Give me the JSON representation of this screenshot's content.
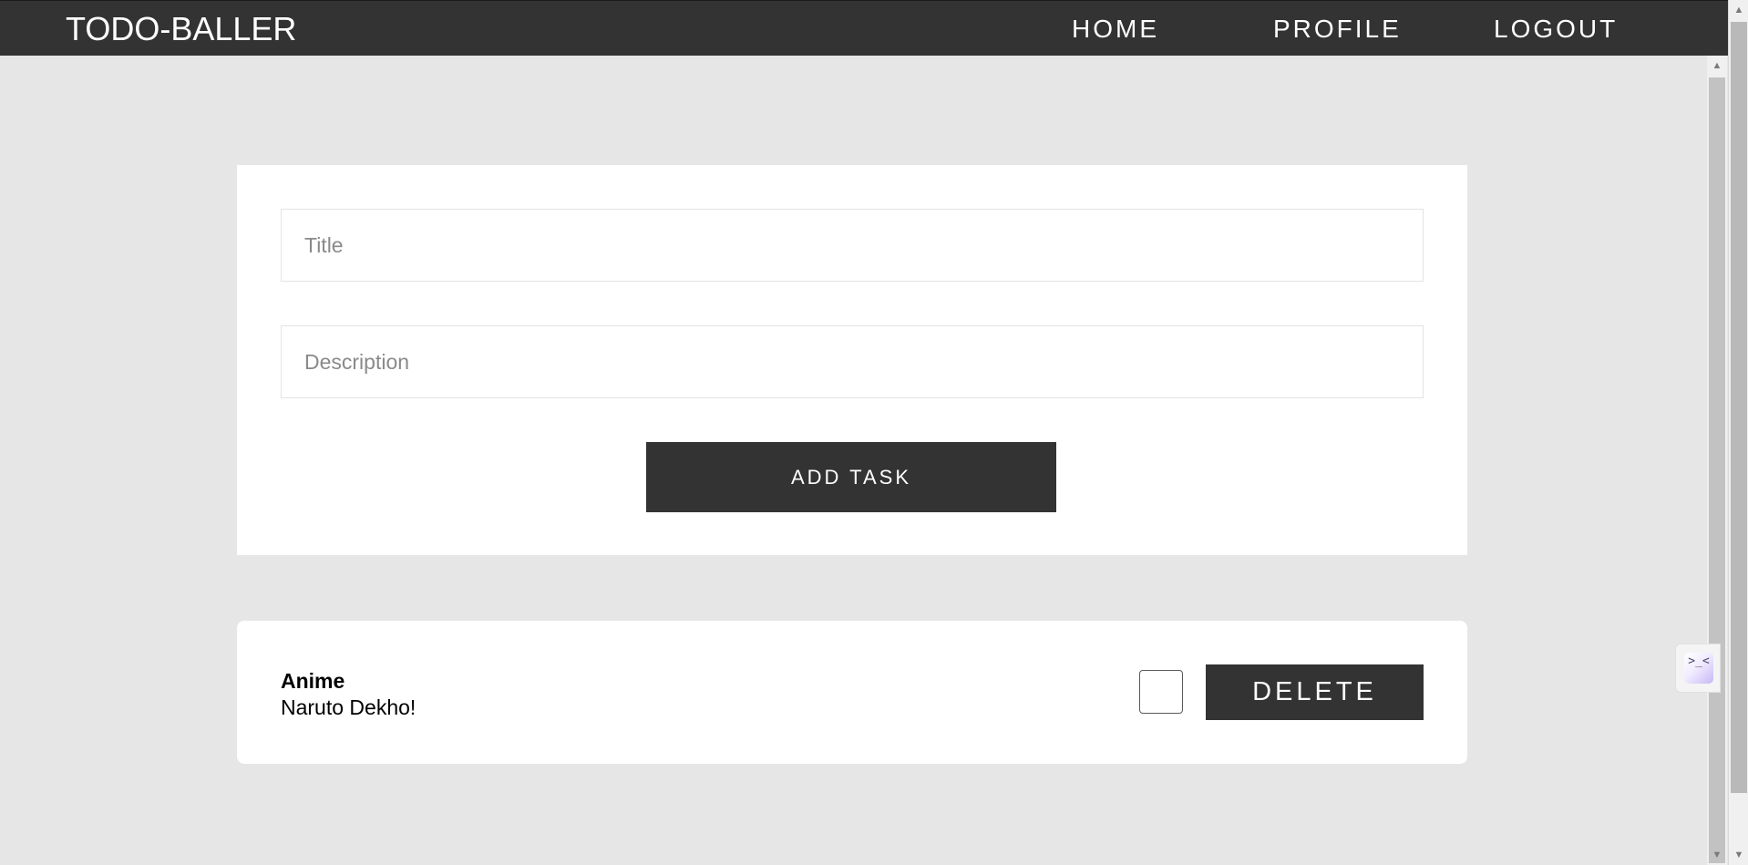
{
  "navbar": {
    "brand": "TODO-BALLER",
    "links": [
      {
        "label": "HOME"
      },
      {
        "label": "PROFILE"
      },
      {
        "label": "LOGOUT"
      }
    ]
  },
  "form": {
    "title_placeholder": "Title",
    "title_value": "",
    "description_placeholder": "Description",
    "description_value": "",
    "add_button_label": "ADD TASK"
  },
  "tasks": [
    {
      "title": "Anime",
      "description": "Naruto Dekho!",
      "completed": false,
      "delete_label": "DELETE"
    }
  ],
  "scrollbar": {
    "up_arrow": "▲",
    "down_arrow": "▼"
  },
  "side_widget": {
    "icon": "terminal-icon",
    "glyph": ">_<"
  },
  "colors": {
    "navbar": "#333333",
    "page_background": "#e6e6e6",
    "card_background": "#ffffff",
    "button": "#333333",
    "button_text": "#ffffff"
  }
}
